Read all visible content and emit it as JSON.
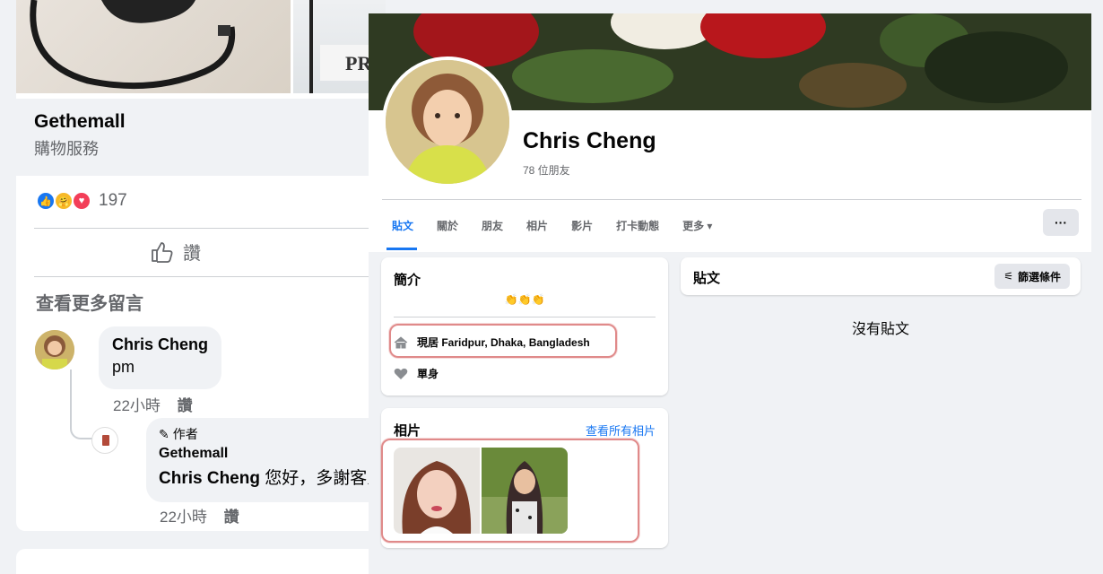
{
  "left": {
    "link_title": "Gethemall",
    "link_subtitle": "購物服務",
    "reaction_count": "197",
    "like_label": "讚",
    "more_comments": "查看更多留言",
    "comment1": {
      "name": "Chris Cheng",
      "text": "pm",
      "time": "22小時",
      "like": "讚"
    },
    "comment2": {
      "badge": "作者",
      "name": "Gethemall",
      "mention": "Chris Cheng",
      "text": " 您好，多謝客人",
      "time": "22小時",
      "like": "讚"
    },
    "photo2_text": "PR"
  },
  "profile": {
    "name": "Chris Cheng",
    "friends": "78 位朋友",
    "tabs": [
      "貼文",
      "關於",
      "朋友",
      "相片",
      "影片",
      "打卡動態",
      "更多 ▾"
    ],
    "more_button": "···",
    "intro": {
      "title": "簡介",
      "bio": "👏👏👏",
      "lives_in": "現居 Faridpur, Dhaka, Bangladesh",
      "relationship": "單身"
    },
    "photos": {
      "title": "相片",
      "see_all": "查看所有相片"
    },
    "posts": {
      "title": "貼文",
      "filter": "篩選條件",
      "empty": "沒有貼文"
    }
  },
  "colors": {
    "accent": "#1877f2",
    "highlight_circle": "#e08a8a"
  }
}
